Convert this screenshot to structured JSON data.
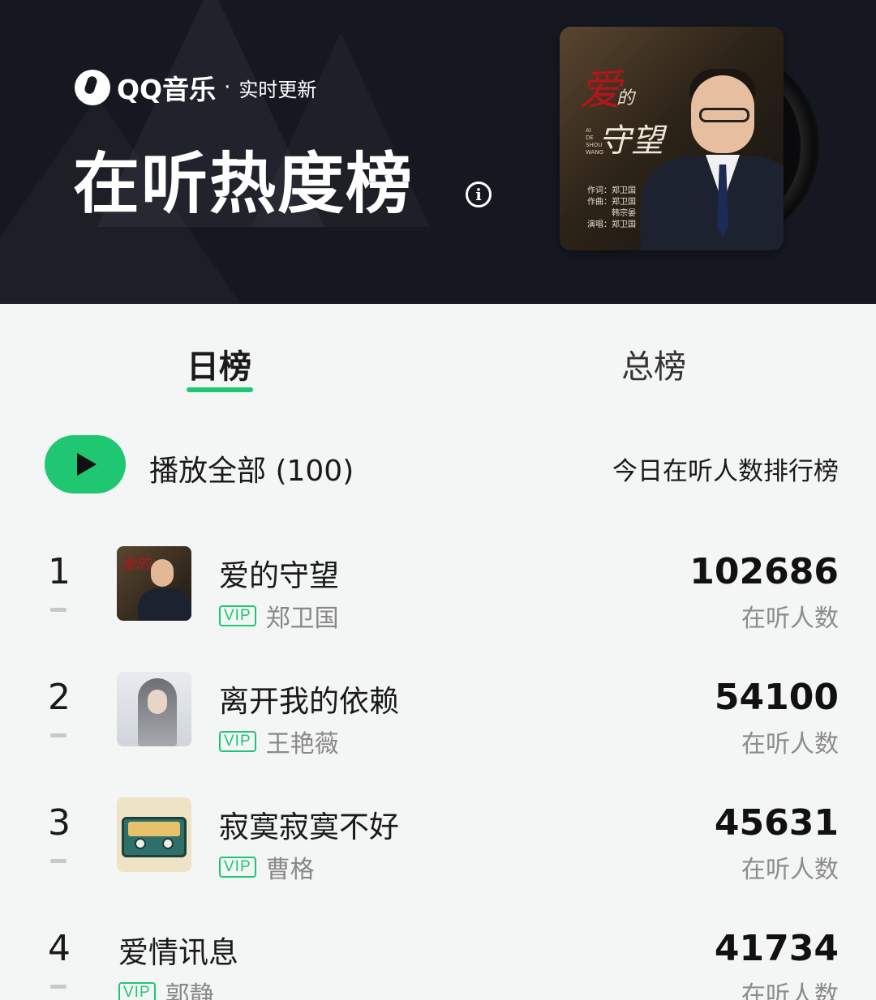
{
  "header": {
    "brand_name": "QQ音乐",
    "brand_dot": "·",
    "brand_sub": "实时更新",
    "title": "在听热度榜",
    "info_icon": "info-icon",
    "cover": {
      "title_1": "爱",
      "title_2": "的",
      "title_3": "守望",
      "pinyin": [
        "AI",
        "DE",
        "SHOU",
        "WANG"
      ],
      "credits": [
        "作词：郑卫国",
        "作曲：郑卫国",
        "韩宗晏",
        "演唱：郑卫国"
      ]
    }
  },
  "tabs": [
    {
      "label": "日榜",
      "active": true
    },
    {
      "label": "总榜",
      "active": false
    }
  ],
  "play_row": {
    "play_icon": "play-icon",
    "play_all": "播放全部 (100)",
    "description": "今日在听人数排行榜"
  },
  "songs": [
    {
      "rank": "1",
      "title": "爱的守望",
      "vip": "VIP",
      "artist": "郑卫国",
      "count": "102686",
      "count_label": "在听人数",
      "thumb_text": "爱的"
    },
    {
      "rank": "2",
      "title": "离开我的依赖",
      "vip": "VIP",
      "artist": "王艳薇",
      "count": "54100",
      "count_label": "在听人数"
    },
    {
      "rank": "3",
      "title": "寂寞寂寞不好",
      "vip": "VIP",
      "artist": "曹格",
      "count": "45631",
      "count_label": "在听人数"
    },
    {
      "rank": "4",
      "title": "爱情讯息",
      "vip": "VIP",
      "artist": "郭静",
      "count": "41734",
      "count_label": "在听人数"
    }
  ],
  "colors": {
    "header_bg": "#161821",
    "accent_green": "#1fc773",
    "page_bg": "#f4f6f6"
  }
}
